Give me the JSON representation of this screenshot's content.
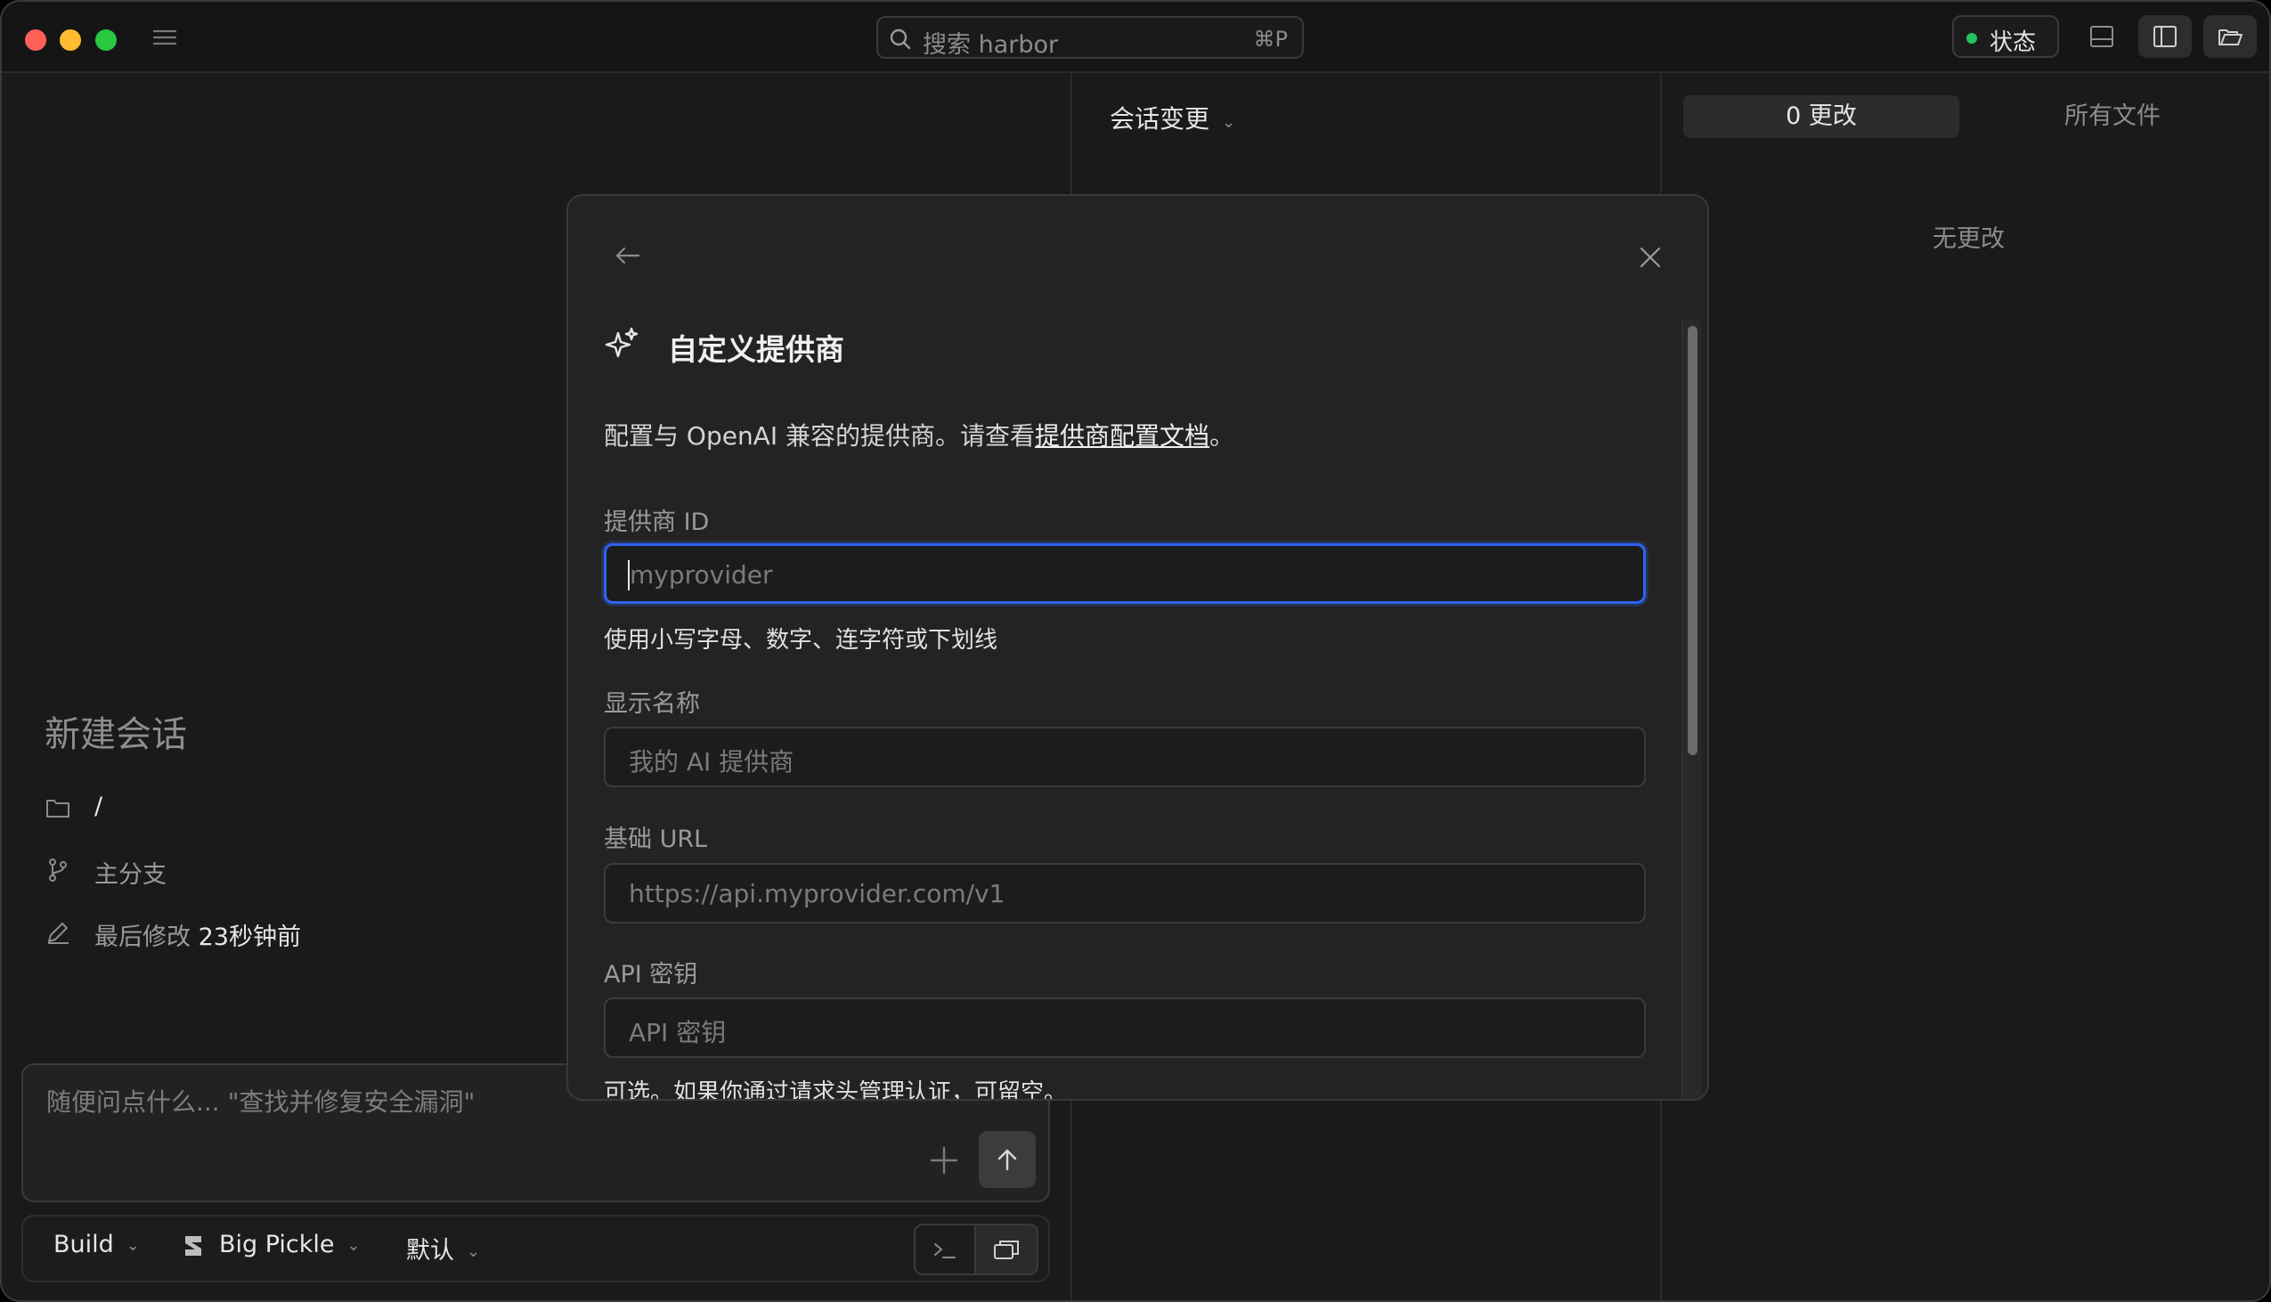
{
  "titlebar": {
    "search_placeholder": "搜索 harbor",
    "search_shortcut": "⌘P",
    "status_label": "状态"
  },
  "session": {
    "title": "新建会话",
    "path": "/",
    "branch": "主分支",
    "modified_label": "最后修改",
    "modified_value": "23秒钟前"
  },
  "composer": {
    "placeholder": "随便问点什么... \"查找并修复安全漏洞\""
  },
  "bottom_bar": {
    "agent": "Build",
    "model": "Big Pickle",
    "variant": "默认"
  },
  "changes_panel": {
    "title": "会话变更"
  },
  "files_panel": {
    "tab_changes": "0 更改",
    "tab_all_files": "所有文件",
    "empty_text": "无更改"
  },
  "dialog": {
    "title": "自定义提供商",
    "description_prefix": "配置与 OpenAI 兼容的提供商。请查看",
    "description_link": "提供商配置文档",
    "description_suffix": "。",
    "fields": [
      {
        "label": "提供商 ID",
        "placeholder": "myprovider",
        "help": "使用小写字母、数字、连字符或下划线"
      },
      {
        "label": "显示名称",
        "placeholder": "我的 AI 提供商"
      },
      {
        "label": "基础 URL",
        "placeholder": "https://api.myprovider.com/v1"
      },
      {
        "label": "API 密钥",
        "placeholder": "API 密钥",
        "help": "可选。如果你通过请求头管理认证，可留空。"
      }
    ]
  },
  "colors": {
    "accent_focus": "#2e64f5",
    "status_ok": "#22c55e",
    "background": "#1b1a1a",
    "dialog_bg": "#242323"
  }
}
